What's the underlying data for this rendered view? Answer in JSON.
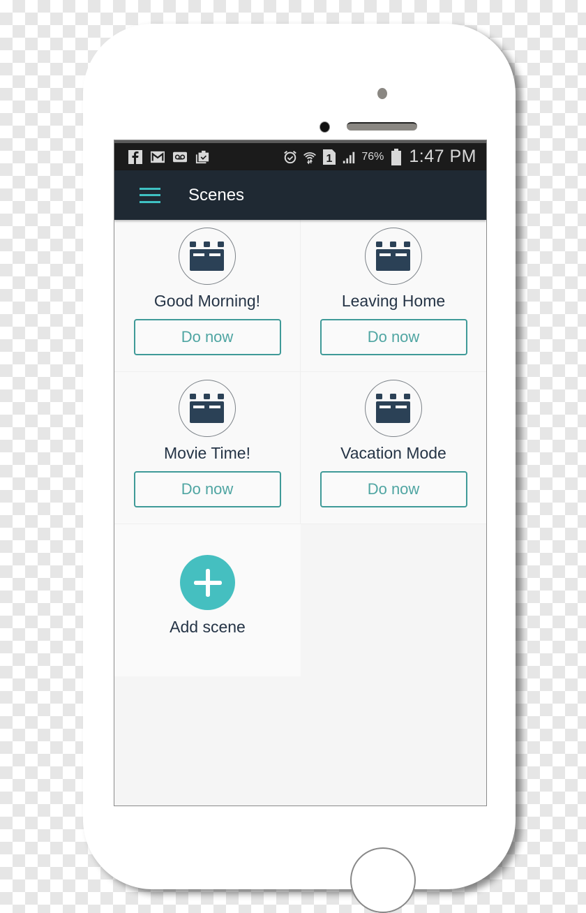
{
  "statusbar": {
    "left_icons": [
      "facebook-icon",
      "gmail-icon",
      "voicemail-icon",
      "clipboard-check-icon"
    ],
    "right_icons": [
      "alarm-icon",
      "wifi-icon",
      "sim-1-icon",
      "signal-icon"
    ],
    "battery_percent": "76%",
    "time": "1:47 PM"
  },
  "toolbar": {
    "menu_icon": "hamburger-menu-icon",
    "title": "Scenes"
  },
  "colors": {
    "accent": "#45bfc0",
    "toolbar_bg": "#1f2933",
    "icon_dark": "#2b4156",
    "button_border": "#3f9a98"
  },
  "scenes": [
    {
      "name": "Good Morning!",
      "icon": "clapperboard-icon",
      "action_label": "Do now"
    },
    {
      "name": "Leaving Home",
      "icon": "clapperboard-icon",
      "action_label": "Do now"
    },
    {
      "name": "Movie Time!",
      "icon": "clapperboard-icon",
      "action_label": "Do now"
    },
    {
      "name": "Vacation Mode",
      "icon": "clapperboard-icon",
      "action_label": "Do now"
    }
  ],
  "add_scene": {
    "icon": "plus-icon",
    "label": "Add scene"
  }
}
